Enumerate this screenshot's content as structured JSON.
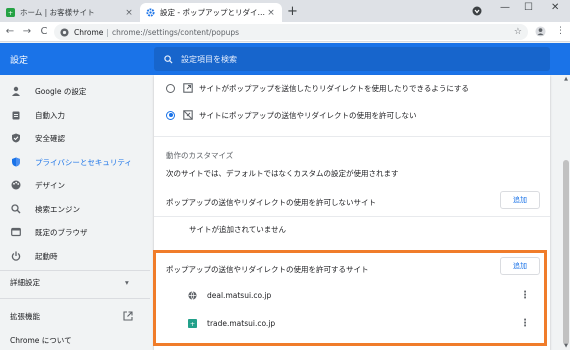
{
  "tabs": [
    {
      "title": "ホーム | お客様サイト",
      "close": "×"
    },
    {
      "title": "設定 - ポップアップとリダイレクト",
      "close": "×"
    }
  ],
  "new_tab": "+",
  "window_controls": {
    "minimize": "—",
    "maximize": "☐",
    "close": "✕"
  },
  "toolbar": {
    "back": "←",
    "forward": "→",
    "reload": "C",
    "scheme": "Chrome",
    "separator": "|",
    "url": "chrome://settings/content/popups",
    "star": "☆",
    "menu": "⋮"
  },
  "header": {
    "title": "設定",
    "search_placeholder": "設定項目を検索"
  },
  "sidebar": {
    "items": [
      {
        "label": "Google の設定",
        "icon": "person-icon"
      },
      {
        "label": "自動入力",
        "icon": "clipboard-icon"
      },
      {
        "label": "安全確認",
        "icon": "shield-check-icon"
      },
      {
        "label": "プライバシーとセキュリティ",
        "icon": "shield-icon",
        "active": true
      },
      {
        "label": "デザイン",
        "icon": "palette-icon"
      },
      {
        "label": "検索エンジン",
        "icon": "search-icon"
      },
      {
        "label": "既定のブラウザ",
        "icon": "browser-icon"
      },
      {
        "label": "起動時",
        "icon": "power-icon"
      }
    ],
    "advanced": "詳細設定",
    "advanced_arrow": "▾",
    "extensions": "拡張機能",
    "about": "Chrome について"
  },
  "main": {
    "options": [
      {
        "label": "サイトがポップアップを送信したりリダイレクトを使用したりできるようにする",
        "checked": false
      },
      {
        "label": "サイトにポップアップの送信やリダイレクトの使用を許可しない",
        "checked": true
      }
    ],
    "custom_title": "動作のカスタマイズ",
    "custom_desc": "次のサイトでは、デフォルトではなくカスタムの設定が使用されます",
    "block_label": "ポップアップの送信やリダイレクトの使用を許可しないサイト",
    "add_label": "追加",
    "empty_note": "サイトが追加されていません",
    "allow_label": "ポップアップの送信やリダイレクトの使用を許可するサイト",
    "sites": [
      {
        "domain": "deal.matsui.co.jp",
        "icon": "globe-icon"
      },
      {
        "domain": "trade.matsui.co.jp",
        "icon": "site-favicon-icon"
      }
    ],
    "more": "⋮"
  },
  "colors": {
    "accent": "#1a73e8",
    "highlight": "#f07c2a"
  }
}
